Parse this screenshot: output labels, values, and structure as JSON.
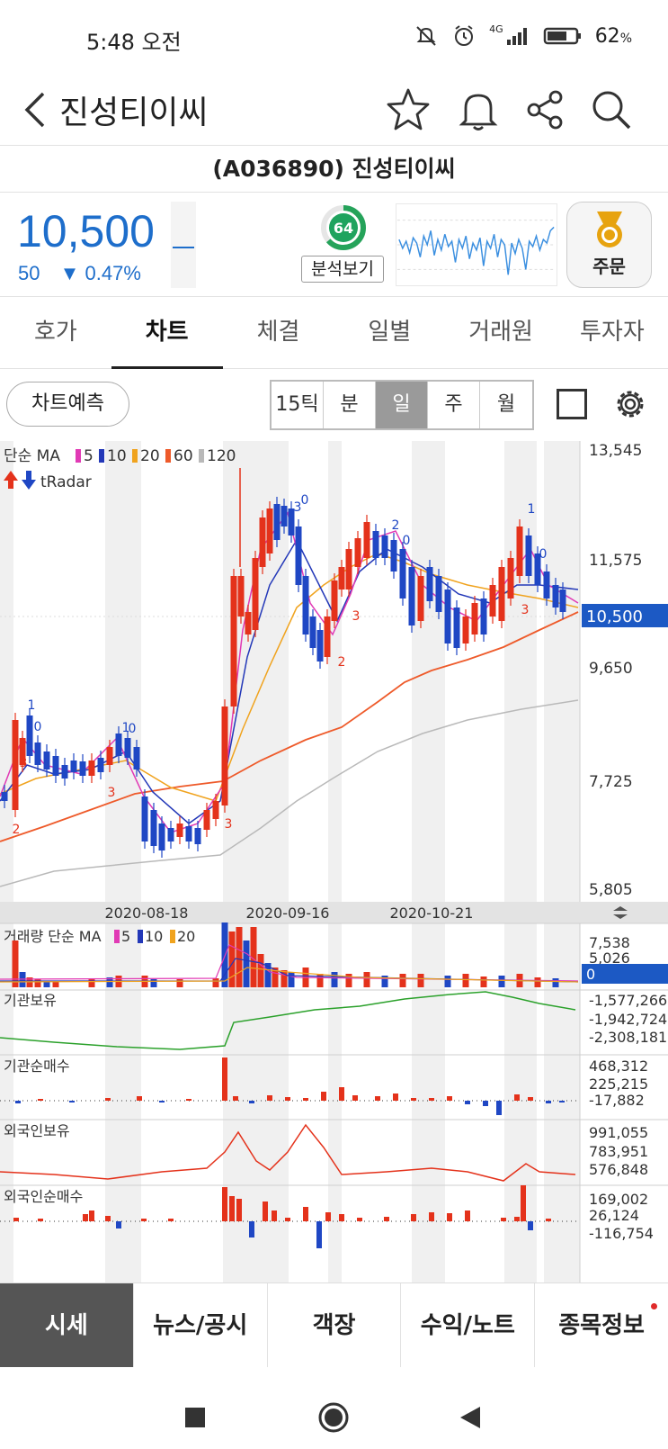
{
  "status": {
    "time": "5:48 오전",
    "battery": "62",
    "battery_unit": "%",
    "network": "4G"
  },
  "header": {
    "title": "진성티이씨"
  },
  "stock": {
    "code_label": "(A036890) 진성티이씨",
    "price": "10,500",
    "change_amount": "50",
    "change_pct": "0.47%",
    "score": "64",
    "analysis_label": "분석보기",
    "order_label": "주문"
  },
  "tabs": [
    "호가",
    "차트",
    "체결",
    "일별",
    "거래원",
    "투자자"
  ],
  "chart_toolbar": {
    "predict_label": "차트예측",
    "periods": [
      "15틱",
      "분",
      "일",
      "주",
      "월"
    ],
    "active_period": "일"
  },
  "colors": {
    "up": "#e4321b",
    "down": "#1f47c4",
    "ma5": "#e13ab5",
    "ma10": "#2338b8",
    "ma20": "#f0a31e",
    "ma60": "#ee5a2a",
    "ma120": "#b9b9b9",
    "accent": "#1e6ecb"
  },
  "chart_data": [
    {
      "type": "candlestick",
      "legend_prefix": "단순 MA",
      "ma_periods": [
        "5",
        "10",
        "20",
        "60",
        "120"
      ],
      "overlay_label": "tRadar",
      "y_ticks": [
        "13,545",
        "11,575",
        "9,650",
        "7,725",
        "5,805"
      ],
      "current_price_label": "10,500",
      "x_labels": [
        "2020-08-18",
        "2020-09-16",
        "2020-10-21"
      ],
      "signal_labels": [
        "1",
        "0",
        "3",
        "2",
        "1",
        "0",
        "3",
        "3",
        "0",
        "3",
        "2",
        "2",
        "0",
        "3",
        "1",
        "0",
        "3"
      ]
    },
    {
      "type": "bar",
      "title": "거래량 단순 MA",
      "ma_periods": [
        "5",
        "10",
        "20"
      ],
      "y_ticks": [
        "7,538",
        "5,026",
        "0"
      ]
    },
    {
      "type": "line",
      "title": "기관보유",
      "y_ticks": [
        "-1,577,266",
        "-1,942,724",
        "-2,308,181"
      ]
    },
    {
      "type": "bar",
      "title": "기관순매수",
      "y_ticks": [
        "468,312",
        "225,215",
        "-17,882"
      ]
    },
    {
      "type": "line",
      "title": "외국인보유",
      "y_ticks": [
        "991,055",
        "783,951",
        "576,848"
      ]
    },
    {
      "type": "bar",
      "title": "외국인순매수",
      "y_ticks": [
        "169,002",
        "26,124",
        "-116,754"
      ]
    }
  ],
  "bottom_tabs": [
    "시세",
    "뉴스/공시",
    "객장",
    "수익/노트",
    "종목정보"
  ]
}
